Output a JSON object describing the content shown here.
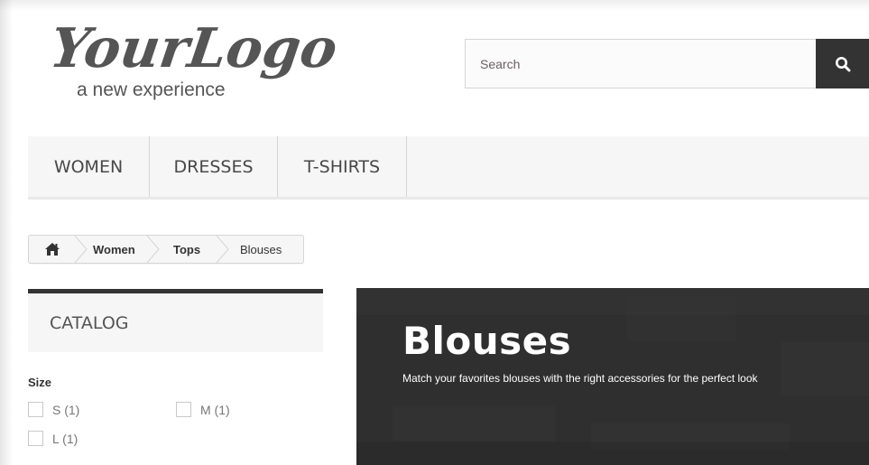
{
  "logo": {
    "main_text": "YourLogo",
    "tagline": "a new experience"
  },
  "search": {
    "placeholder": "Search",
    "button_icon": "search-icon"
  },
  "nav": {
    "items": [
      {
        "label": "WOMEN"
      },
      {
        "label": "DRESSES"
      },
      {
        "label": "T-SHIRTS"
      }
    ]
  },
  "breadcrumb": {
    "home_icon": "home-icon",
    "items": [
      {
        "label": "Women"
      },
      {
        "label": "Tops"
      },
      {
        "label": "Blouses"
      }
    ]
  },
  "sidebar": {
    "block_title": "CATALOG",
    "filter_title": "Size",
    "filters": [
      {
        "label": "S (1)",
        "checked": false
      },
      {
        "label": "M (1)",
        "checked": false
      },
      {
        "label": "L (1)",
        "checked": false
      }
    ]
  },
  "category": {
    "title": "Blouses",
    "description": "Match your favorites blouses with the right accessories for the perfect look"
  },
  "colors": {
    "dark": "#333333",
    "nav_bg": "#f6f6f6",
    "banner_bg": "#2f2f2f",
    "text": "#484848"
  }
}
